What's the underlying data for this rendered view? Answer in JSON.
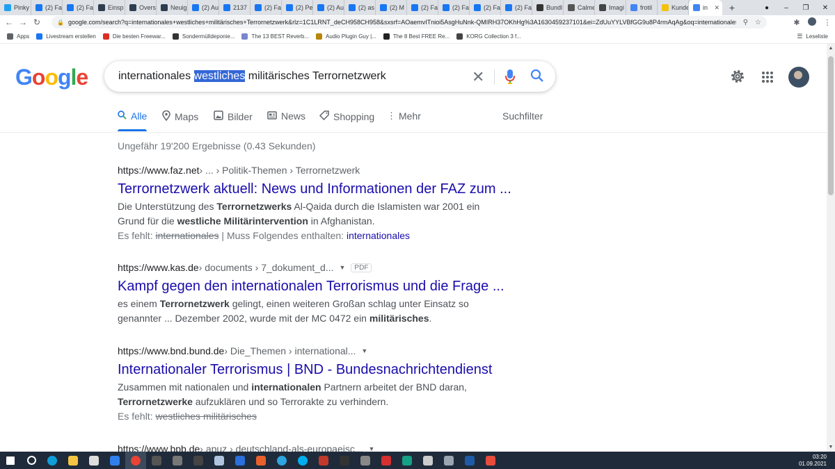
{
  "browser": {
    "tabs": [
      {
        "label": "Pinky",
        "icon": "twitter-icon",
        "color": "#1da1f2"
      },
      {
        "label": "(2) Fa",
        "icon": "facebook-icon",
        "color": "#1877f2"
      },
      {
        "label": "(2) Fa",
        "icon": "facebook-icon",
        "color": "#1877f2"
      },
      {
        "label": "Einsp",
        "icon": "app-icon",
        "color": "#2c3e50"
      },
      {
        "label": "Overs",
        "icon": "app-icon",
        "color": "#2c3e50"
      },
      {
        "label": "Neuig",
        "icon": "app-icon",
        "color": "#2c3e50"
      },
      {
        "label": "(2) Au",
        "icon": "facebook-icon",
        "color": "#1877f2"
      },
      {
        "label": "2137",
        "icon": "facebook-f-icon",
        "color": "#1877f2"
      },
      {
        "label": "(2) Fa",
        "icon": "facebook-icon",
        "color": "#1877f2"
      },
      {
        "label": "(2) Pe",
        "icon": "facebook-icon",
        "color": "#1877f2"
      },
      {
        "label": "(2) Au",
        "icon": "facebook-icon",
        "color": "#1877f2"
      },
      {
        "label": "(2) as",
        "icon": "facebook-icon",
        "color": "#1877f2"
      },
      {
        "label": "(2) M",
        "icon": "facebook-icon",
        "color": "#1877f2"
      },
      {
        "label": "(2) Fa",
        "icon": "facebook-icon",
        "color": "#1877f2"
      },
      {
        "label": "(2) Fa",
        "icon": "facebook-icon",
        "color": "#1877f2"
      },
      {
        "label": "(2) Fa",
        "icon": "facebook-icon",
        "color": "#1877f2"
      },
      {
        "label": "(2) Fa",
        "icon": "facebook-icon",
        "color": "#1877f2"
      },
      {
        "label": "Bundl",
        "icon": "app-icon",
        "color": "#333333"
      },
      {
        "label": "Calme",
        "icon": "app-icon",
        "color": "#555555"
      },
      {
        "label": "Imagi",
        "icon": "app-icon",
        "color": "#444444"
      },
      {
        "label": "frotil",
        "icon": "google-icon",
        "color": "#4285f4"
      },
      {
        "label": "Kunde",
        "icon": "app-icon",
        "color": "#f4c20d"
      },
      {
        "label": "in",
        "icon": "google-icon",
        "color": "#4285f4",
        "active": true
      }
    ],
    "url": "google.com/search?q=internationales+westliches+militärisches+Terrornetzwerk&rlz=1C1LRNT_deCH958CH958&sxsrf=AOaemvITnioi5AsgHuNnk-QMIRH37OKhHg%3A1630459237101&ei=ZdUuYYLVBfGG9u8P4rmAqAg&oq=internationales+westliches+milit...",
    "bookmarks": [
      {
        "label": "Apps",
        "icon": "apps-grid-icon",
        "color": "#5f6368"
      },
      {
        "label": "Livestream erstellen",
        "icon": "facebook-icon",
        "color": "#1877f2"
      },
      {
        "label": "Die besten Freewar...",
        "icon": "star-icon",
        "color": "#d93025"
      },
      {
        "label": "Sondermülldeponie...",
        "icon": "w-icon",
        "color": "#333333"
      },
      {
        "label": "The 13 BEST Reverb...",
        "icon": "app-icon",
        "color": "#7986cb"
      },
      {
        "label": "Audio Plugin Guy |...",
        "icon": "app-icon",
        "color": "#b8860b"
      },
      {
        "label": "The 8 Best FREE Re...",
        "icon": "app-icon",
        "color": "#222222"
      },
      {
        "label": "KORG Collection 3 f...",
        "icon": "app-icon",
        "color": "#444444"
      }
    ],
    "reading_list": "Leseliste"
  },
  "search": {
    "query_before": "internationales ",
    "query_highlight": "westliches",
    "query_after": " militärisches Terrornetzwerk"
  },
  "logo": [
    "G",
    "o",
    "o",
    "g",
    "l",
    "e"
  ],
  "colors": {
    "blue": "#4285f4",
    "red": "#ea4335",
    "yellow": "#fbbc05",
    "green": "#34a853",
    "link": "#1a0dab",
    "accent": "#1a73e8"
  },
  "nav": {
    "tabs": [
      {
        "label": "Alle",
        "icon": "search-icon",
        "active": true
      },
      {
        "label": "Maps",
        "icon": "map-pin-icon"
      },
      {
        "label": "Bilder",
        "icon": "image-icon"
      },
      {
        "label": "News",
        "icon": "news-icon"
      },
      {
        "label": "Shopping",
        "icon": "tag-icon"
      },
      {
        "label": "Mehr",
        "icon": "more-vert-icon"
      }
    ],
    "tools": "Suchfilter"
  },
  "stats": "Ungefähr 19'200 Ergebnisse (0.43 Sekunden)",
  "results": [
    {
      "site": "https://www.faz.net",
      "path": " › ... › Politik-Themen › Terrornetzwerk",
      "title": "Terrornetzwerk aktuell: News und Informationen der FAZ zum ...",
      "snippet_html": "Die Unterstützung des <b>Terrornetzwerks</b> Al-Qaida durch die Islamisten war 2001 ein Grund für die <b>westliche Militärintervention</b> in Afghanistan.",
      "missing_label": "Es fehlt: ",
      "missing_terms": "internationales",
      "missing_sep": " | Muss Folgendes enthalten: ",
      "missing_link": "internationales"
    },
    {
      "site": "https://www.kas.de",
      "path": " › documents › 7_dokument_d...",
      "pdf": "PDF",
      "title": "Kampf gegen den internationalen Terrorismus und die Frage ...",
      "snippet_html": "es einem <b>Terrornetzwerk</b> gelingt, einen weiteren Großan schlag unter Einsatz so genannter ... Dezember 2002, wurde mit der MC 0472 ein <b>militärisches</b>."
    },
    {
      "site": "https://www.bnd.bund.de",
      "path": " › Die_Themen › international...",
      "title": "Internationaler Terrorismus | BND - Bundesnachrichtendienst",
      "snippet_html": "Zusammen mit nationalen und <b>internationalen</b> Partnern arbeitet der BND daran, <b>Terrornetzwerke</b> aufzuklären und so Terrorakte zu verhindern.",
      "missing_label": "Es fehlt: ",
      "missing_terms": "westliches militärisches"
    },
    {
      "site": "https://www.bpb.de",
      "path": " › apuz › deutschland-als-europaeisc..."
    }
  ],
  "taskbar": {
    "time": "03:20",
    "date": "01.09.2021",
    "apps": [
      {
        "icon": "windows-start-icon",
        "color": "#ffffff"
      },
      {
        "icon": "search-icon",
        "color": "#ffffff"
      },
      {
        "icon": "edge-icon",
        "color": "#0f9ed8"
      },
      {
        "icon": "file-explorer-icon",
        "color": "#f4c542"
      },
      {
        "icon": "store-icon",
        "color": "#dddddd"
      },
      {
        "icon": "mail-icon",
        "color": "#2f80ed"
      },
      {
        "icon": "chrome-icon",
        "color": "#ea4335",
        "active": true
      },
      {
        "icon": "app-icon",
        "color": "#555555"
      },
      {
        "icon": "app-icon",
        "color": "#777777"
      },
      {
        "icon": "app-icon",
        "color": "#444444"
      },
      {
        "icon": "app-icon",
        "color": "#b0c4de"
      },
      {
        "icon": "app-icon",
        "color": "#2a6fdb"
      },
      {
        "icon": "app-icon",
        "color": "#e8602c"
      },
      {
        "icon": "telegram-icon",
        "color": "#2ca5e0"
      },
      {
        "icon": "skype-icon",
        "color": "#00aff0"
      },
      {
        "icon": "app-icon",
        "color": "#c0392b"
      },
      {
        "icon": "app-icon",
        "color": "#333333"
      },
      {
        "icon": "app-icon",
        "color": "#888888"
      },
      {
        "icon": "app-icon",
        "color": "#d63031"
      },
      {
        "icon": "app-icon",
        "color": "#16a085"
      },
      {
        "icon": "app-icon",
        "color": "#cccccc"
      },
      {
        "icon": "app-icon",
        "color": "#9aa5b1"
      },
      {
        "icon": "app-icon",
        "color": "#1e5aa8"
      },
      {
        "icon": "app-icon",
        "color": "#e74c3c"
      }
    ]
  }
}
